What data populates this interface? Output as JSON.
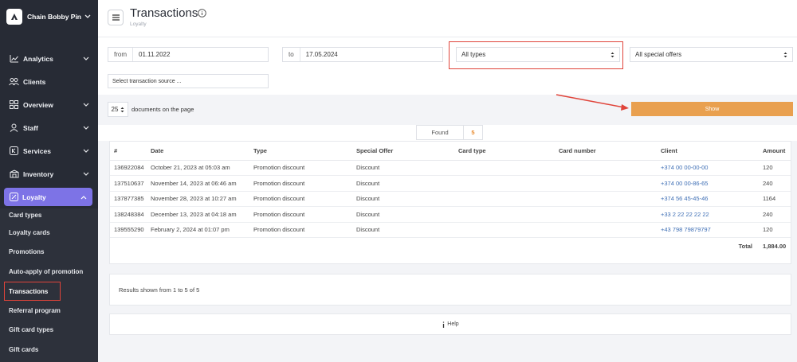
{
  "sidebar": {
    "org_name": "Chain Bobby Pin",
    "items": [
      {
        "label": "Analytics",
        "icon": "chart-icon"
      },
      {
        "label": "Clients",
        "icon": "users-icon"
      },
      {
        "label": "Overview",
        "icon": "grid-icon"
      },
      {
        "label": "Staff",
        "icon": "person-icon"
      },
      {
        "label": "Services",
        "icon": "services-icon"
      },
      {
        "label": "Inventory",
        "icon": "box-icon"
      }
    ],
    "loyalty_label": "Loyalty",
    "loyalty_items": [
      "Card types",
      "Loyalty cards",
      "Promotions",
      "Auto-apply of promotion",
      "Transactions",
      "Referral program",
      "Gift card types",
      "Gift cards"
    ],
    "active_item": "Transactions"
  },
  "header": {
    "title": "Transactions",
    "subtitle": "Loyalty"
  },
  "filters": {
    "from_label": "from",
    "from_value": "01.11.2022",
    "to_label": "to",
    "to_value": "17.05.2024",
    "type_select": "All types",
    "offers_select": "All special offers",
    "source_placeholder": "Select transaction source ..."
  },
  "paging": {
    "per_page": "25",
    "per_page_label": "documents on the page",
    "show_button": "Show"
  },
  "found": {
    "label": "Found",
    "value": "5"
  },
  "table": {
    "headers": [
      "#",
      "Date",
      "Type",
      "Special Offer",
      "Card type",
      "Card number",
      "Client",
      "Amount"
    ],
    "rows": [
      {
        "id": "136922084",
        "date": "October 21, 2023 at 05:03 am",
        "type": "Promotion discount",
        "offer": "Discount",
        "card_type": "",
        "card_number": "",
        "client": "+374 00 00-00-00",
        "amount": "120"
      },
      {
        "id": "137510637",
        "date": "November 14, 2023 at 06:46 am",
        "type": "Promotion discount",
        "offer": "Discount",
        "card_type": "",
        "card_number": "",
        "client": "+374 00 00-86-65",
        "amount": "240"
      },
      {
        "id": "137877385",
        "date": "November 28, 2023 at 10:27 am",
        "type": "Promotion discount",
        "offer": "Discount",
        "card_type": "",
        "card_number": "",
        "client": "+374 56 45-45-46",
        "amount": "1164"
      },
      {
        "id": "138248384",
        "date": "December 13, 2023 at 04:18 am",
        "type": "Promotion discount",
        "offer": "Discount",
        "card_type": "",
        "card_number": "",
        "client": "+33 2 22 22 22 22",
        "amount": "240"
      },
      {
        "id": "139555290",
        "date": "February 2, 2024 at 01:07 pm",
        "type": "Promotion discount",
        "offer": "Discount",
        "card_type": "",
        "card_number": "",
        "client": "+43 798 79879797",
        "amount": "120"
      }
    ],
    "total_label": "Total",
    "total_value": "1,884.00"
  },
  "results_text": "Results shown from 1 to 5 of 5",
  "help_label": "Help",
  "colors": {
    "sidebar_bg": "#272b35",
    "accent": "#7d73e6",
    "show_button": "#e9a04f",
    "highlight": "#e0443a",
    "link": "#3f6fb5"
  }
}
